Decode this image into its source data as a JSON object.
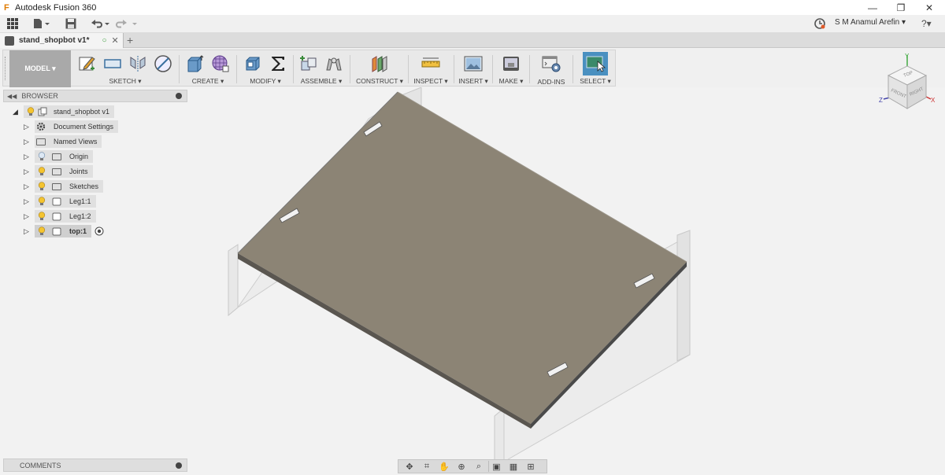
{
  "window": {
    "title": "Autodesk Fusion 360",
    "minimize": "—",
    "restore": "❐",
    "close": "✕"
  },
  "quick_access": {
    "user_name": "S M Anamul Arefin ▾",
    "help": "?▾"
  },
  "doc_tab": {
    "name": "stand_shopbot v1*",
    "sync_glyph": "○",
    "close_glyph": "✕",
    "new_tab_glyph": "+"
  },
  "toolbar": {
    "workspace": "MODEL ▾",
    "groups": {
      "sketch": "SKETCH ▾",
      "create": "CREATE ▾",
      "modify": "MODIFY ▾",
      "assemble": "ASSEMBLE ▾",
      "construct": "CONSTRUCT ▾",
      "inspect": "INSPECT ▾",
      "insert": "INSERT ▾",
      "make": "MAKE ▾",
      "addins": "ADD-INS",
      "select": "SELECT ▾"
    }
  },
  "viewcube": {
    "top": "TOP",
    "front": "FRONT",
    "right": "RIGHT",
    "axis_x": "X",
    "axis_y": "Y",
    "axis_z": "Z"
  },
  "browser": {
    "title": "BROWSER",
    "root": "stand_shopbot v1",
    "items": [
      {
        "label": "Document Settings"
      },
      {
        "label": "Named Views"
      },
      {
        "label": "Origin"
      },
      {
        "label": "Joints"
      },
      {
        "label": "Sketches"
      },
      {
        "label": "Leg1:1"
      },
      {
        "label": "Leg1:2"
      },
      {
        "label": "top:1"
      }
    ]
  },
  "comments": {
    "title": "COMMENTS"
  },
  "colors": {
    "plate_top": "#8c8475",
    "plate_edge": "#4a4a4a",
    "select_blue": "#4a90c0",
    "workspace_bg": "#a9a9a9"
  }
}
